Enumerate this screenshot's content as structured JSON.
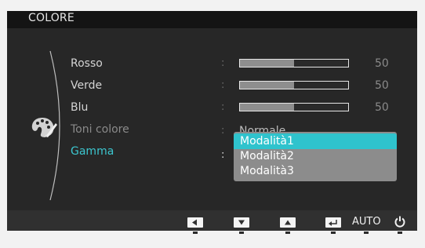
{
  "header": {
    "title": "COLORE"
  },
  "menu": {
    "items": [
      {
        "label": "Rosso",
        "value": 50,
        "fraction": 0.5
      },
      {
        "label": "Verde",
        "value": 50,
        "fraction": 0.5
      },
      {
        "label": "Blu",
        "value": 50,
        "fraction": 0.5
      },
      {
        "label": "Toni colore",
        "value_text": "Normale",
        "state": "disabled"
      },
      {
        "label": "Gamma",
        "state": "active"
      }
    ],
    "separator": ":"
  },
  "dropdown": {
    "options": [
      "Modalità1",
      "Modalità2",
      "Modalità3"
    ],
    "selected": "Modalità1"
  },
  "footer": {
    "buttons": [
      "left-arrow-icon",
      "down-arrow-icon",
      "up-arrow-icon",
      "enter-icon"
    ],
    "auto_label": "AUTO",
    "power_icon": "power-icon"
  },
  "colors": {
    "accent": "#2fc3cd",
    "active_text": "#3cc6cf",
    "panel": "#272727",
    "titlebar": "#141414",
    "bar_fill": "#8e8e8e",
    "dropdown_bg": "#8c8c8c"
  }
}
